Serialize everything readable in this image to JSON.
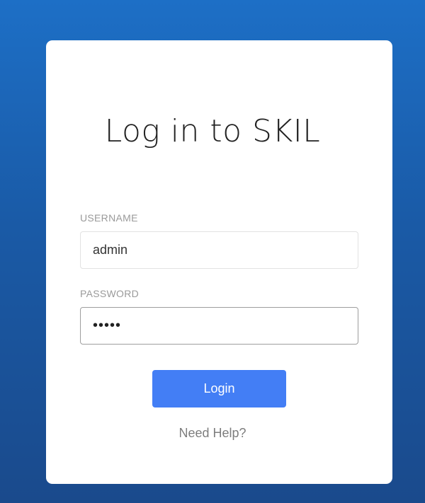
{
  "login": {
    "title": "Log in to SKIL",
    "username_label": "USERNAME",
    "username_value": "admin",
    "password_label": "PASSWORD",
    "password_masked": "•••••",
    "submit_label": "Login",
    "help_link": "Need Help?"
  },
  "colors": {
    "background_top": "#1d6fc6",
    "background_bottom": "#1a4a8c",
    "card": "#ffffff",
    "button": "#437ef5",
    "button_text": "#ffffff"
  }
}
